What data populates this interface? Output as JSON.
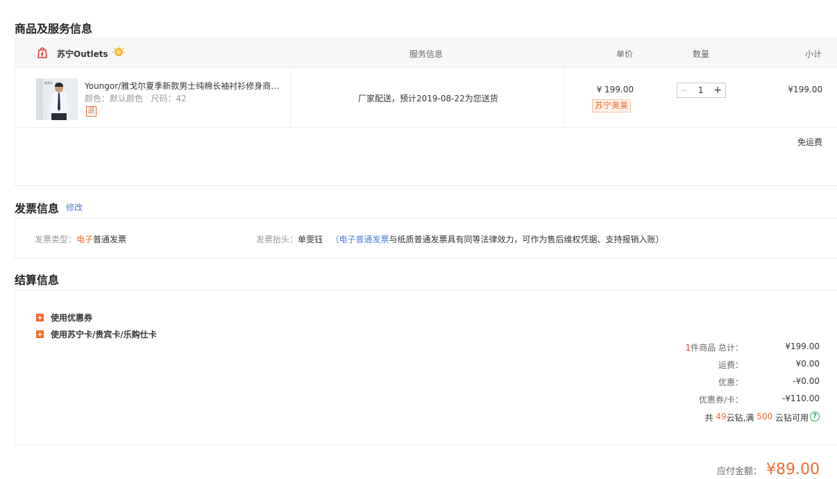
{
  "goods_section": {
    "title": "商品及服务信息",
    "store_name": "苏宁Outlets",
    "headers": {
      "service": "服务信息",
      "unit_price": "单价",
      "quantity": "数量",
      "subtotal": "小计"
    },
    "item": {
      "name": "Youngor/雅戈尔夏季新款男士纯棉长袖衬衫修身商务正装免烫衬衣",
      "spec_color_label": "颜色：",
      "spec_color": "默认颜色",
      "spec_size_label": "尺码：",
      "spec_size": "42",
      "return_tag": "退",
      "service": "厂家配送，预计2019-08-22为您送货",
      "price": "¥ 199.00",
      "store_tag": "苏宁奥莱",
      "qty_minus": "−",
      "qty": "1",
      "qty_plus": "+",
      "subtotal": "¥199.00"
    },
    "shipping": "免运费"
  },
  "invoice_section": {
    "title": "发票信息",
    "edit_link": "修改",
    "type_label": "发票类型：",
    "type_value_highlight": "电子",
    "type_value_rest": "普通发票",
    "title_label": "发票抬头：",
    "title_value": "单雯钰",
    "note_open": "（",
    "note_link": "电子普通发票",
    "note_rest": "与纸质普通发票具有同等法律效力，可作为售后维权凭据、支持报销入账）"
  },
  "settlement_section": {
    "title": "结算信息",
    "use_coupon": "使用优惠券",
    "use_card": "使用苏宁卡/贵宾卡/乐购仕卡",
    "summary": {
      "count": "1",
      "count_label": "件商品 总计：",
      "total": "¥199.00",
      "shipping_label": "运费：",
      "shipping": "¥0.00",
      "discount_label": "优惠：",
      "discount": "-¥0.00",
      "coupon_label": "优惠券/卡：",
      "coupon": "-¥110.00",
      "diamond_prefix": "共",
      "diamond_count": "49",
      "diamond_mid": "云钻,满",
      "diamond_threshold": "500",
      "diamond_suffix": "云钻可用",
      "help": "?"
    },
    "pay_label": "应付金额：",
    "pay_total": "¥89.00"
  },
  "colors": {
    "accent": "#f06a2a",
    "link": "#4a7fd6",
    "help_green": "#2aa55a"
  }
}
